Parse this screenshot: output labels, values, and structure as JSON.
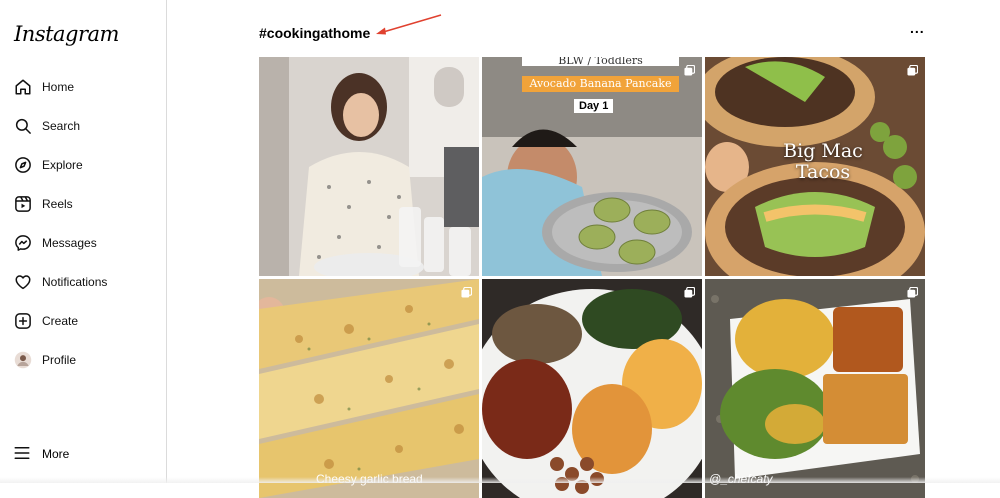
{
  "app": {
    "logo_text": "Instagram"
  },
  "sidebar": {
    "items": [
      {
        "label": "Home",
        "icon": "home-icon"
      },
      {
        "label": "Search",
        "icon": "search-icon"
      },
      {
        "label": "Explore",
        "icon": "compass-icon"
      },
      {
        "label": "Reels",
        "icon": "reels-icon"
      },
      {
        "label": "Messages",
        "icon": "messenger-icon"
      },
      {
        "label": "Notifications",
        "icon": "heart-icon"
      },
      {
        "label": "Create",
        "icon": "plus-square-icon"
      },
      {
        "label": "Profile",
        "icon": "avatar-icon"
      }
    ],
    "more_label": "More"
  },
  "header": {
    "hashtag": "#cookingathome",
    "options_label": "..."
  },
  "posts": [
    {
      "alt": "woman cooking in kitchen",
      "multi": false
    },
    {
      "caption_top": "BLW / Toddlers",
      "banner": "Avocado Banana Pancake",
      "tag": "Day 1",
      "multi": true
    },
    {
      "caption": "Big Mac Tacos",
      "multi": true
    },
    {
      "caption": "Cheesy garlic bread",
      "multi": true
    },
    {
      "alt": "soul food plate",
      "multi": true
    },
    {
      "caption": "@_chefcaty",
      "multi": true
    }
  ],
  "colors": {
    "accent_arrow": "#e0412f",
    "banner_orange": "#f1a33a",
    "border": "#dbdbdb"
  }
}
